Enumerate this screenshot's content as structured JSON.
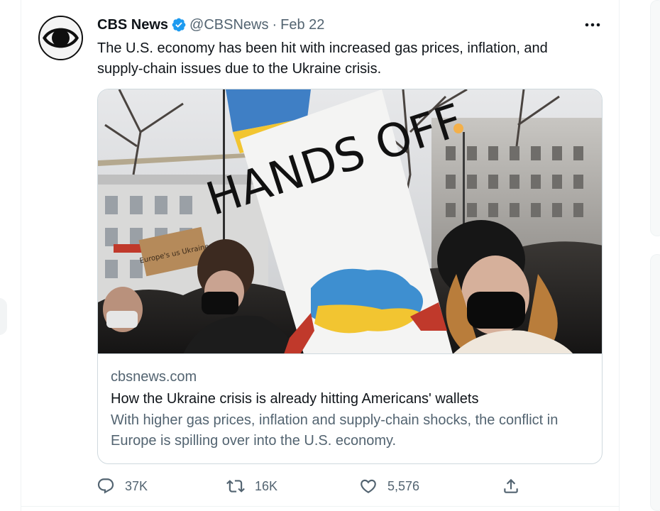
{
  "tweet": {
    "display_name": "CBS News",
    "handle": "@CBSNews",
    "separator": "·",
    "date": "Feb 22",
    "text": "The U.S. economy has been hit with increased gas prices, inflation, and supply-chain issues due to the Ukraine crisis.",
    "avatar_icon": "cbs-eye-logo",
    "verified_icon": "verified-badge-icon",
    "verified_color": "#1d9bf0",
    "more_icon": "more-dots-icon"
  },
  "card": {
    "image_sign_text": "HANDS OFF",
    "image_small_sign_text": "Europe's us Ukraine",
    "domain": "cbsnews.com",
    "title": "How the Ukraine crisis is already hitting Americans' wallets",
    "description": "With higher gas prices, inflation and supply-chain shocks, the conflict in Europe is spilling over into the U.S. economy."
  },
  "actions": {
    "reply": {
      "icon": "reply-icon",
      "count": "37K"
    },
    "retweet": {
      "icon": "retweet-icon",
      "count": "16K"
    },
    "like": {
      "icon": "heart-icon",
      "count": "5,576"
    },
    "share": {
      "icon": "share-icon"
    }
  },
  "colors": {
    "text_primary": "#0f1419",
    "text_secondary": "#536471",
    "border": "#cfd9de",
    "accent": "#1d9bf0"
  }
}
